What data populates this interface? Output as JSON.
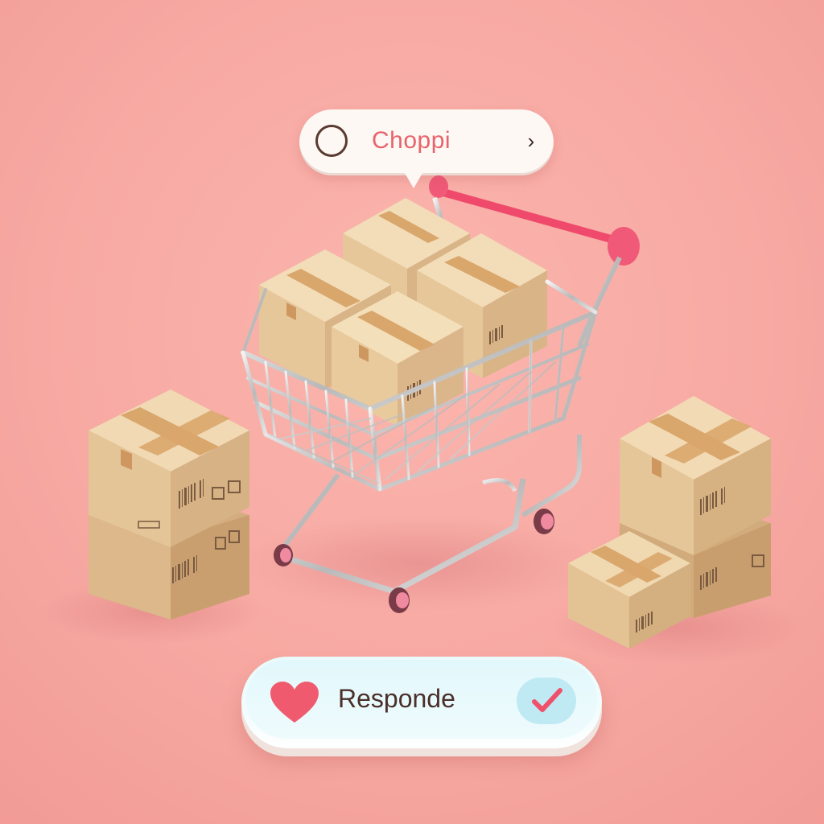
{
  "app": {
    "top_bubble": {
      "label": "Choppi",
      "icon_left": "circle-outline-icon",
      "icon_right": "chevron-right-icon",
      "chevron_glyph": "›"
    },
    "bottom_pill": {
      "label": "Responde",
      "icon_left": "heart-icon",
      "icon_right": "check-icon"
    }
  },
  "colors": {
    "background": "#f7a9a2",
    "accent_red": "#e8636b",
    "heart": "#f05a6e",
    "check_bg": "#bfeaf3",
    "box": "#e5c79e",
    "tape": "#d9a66c",
    "cart_handle": "#ef4a6c"
  }
}
